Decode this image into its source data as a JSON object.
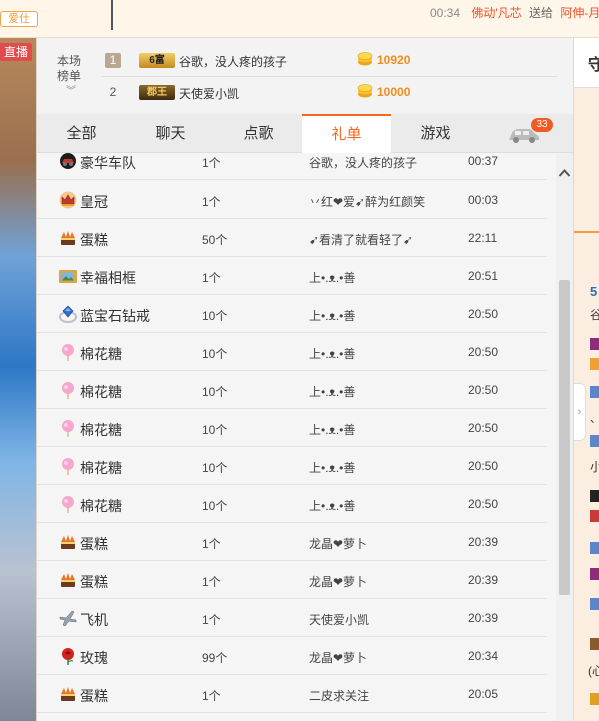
{
  "topbar": {
    "logo": "爱仕",
    "time": "00:34",
    "sender": "佛动'凡芯",
    "action": "送给",
    "receiver": "阿伸-月"
  },
  "video": {
    "live_label": "直播"
  },
  "ranking": {
    "title": "本场榜单",
    "rows": [
      {
        "rank": "1",
        "badge": "6富",
        "name": "谷歌，没人疼的孩子",
        "amount": "10920"
      },
      {
        "rank": "2",
        "badge": "郡王",
        "name": "天使爱小凯",
        "amount": "10000"
      }
    ]
  },
  "tabs": [
    {
      "label": "全部",
      "active": false
    },
    {
      "label": "聊天",
      "active": false
    },
    {
      "label": "点歌",
      "active": false
    },
    {
      "label": "礼单",
      "active": true
    },
    {
      "label": "游戏",
      "active": false
    }
  ],
  "car_badge_count": "33",
  "gifts": [
    {
      "icon": "luxury-car-icon",
      "name": "豪华车队",
      "qty": "1个",
      "user": "谷歌，没人疼的孩子",
      "time": "00:37"
    },
    {
      "icon": "crown-icon",
      "name": "皇冠",
      "qty": "1个",
      "user": "丷红❤爱➹醉为红颜笑",
      "time": "00:03"
    },
    {
      "icon": "cake-icon",
      "name": "蛋糕",
      "qty": "50个",
      "user": "➹看清了就看轻了➹",
      "time": "22:11"
    },
    {
      "icon": "photo-frame-icon",
      "name": "幸福相框",
      "qty": "1个",
      "user": "上•.ᴥ.•善",
      "time": "20:51"
    },
    {
      "icon": "sapphire-ring-icon",
      "name": "蓝宝石钻戒",
      "qty": "10个",
      "user": "上•.ᴥ.•善",
      "time": "20:50"
    },
    {
      "icon": "cotton-candy-icon",
      "name": "棉花糖",
      "qty": "10个",
      "user": "上•.ᴥ.•善",
      "time": "20:50"
    },
    {
      "icon": "cotton-candy-icon",
      "name": "棉花糖",
      "qty": "10个",
      "user": "上•.ᴥ.•善",
      "time": "20:50"
    },
    {
      "icon": "cotton-candy-icon",
      "name": "棉花糖",
      "qty": "10个",
      "user": "上•.ᴥ.•善",
      "time": "20:50"
    },
    {
      "icon": "cotton-candy-icon",
      "name": "棉花糖",
      "qty": "10个",
      "user": "上•.ᴥ.•善",
      "time": "20:50"
    },
    {
      "icon": "cotton-candy-icon",
      "name": "棉花糖",
      "qty": "10个",
      "user": "上•.ᴥ.•善",
      "time": "20:50"
    },
    {
      "icon": "cake-icon",
      "name": "蛋糕",
      "qty": "1个",
      "user": "龙晶❤萝卜",
      "time": "20:39"
    },
    {
      "icon": "cake-icon",
      "name": "蛋糕",
      "qty": "1个",
      "user": "龙晶❤萝卜",
      "time": "20:39"
    },
    {
      "icon": "airplane-icon",
      "name": "飞机",
      "qty": "1个",
      "user": "天使爱小凯",
      "time": "20:39"
    },
    {
      "icon": "rose-icon",
      "name": "玫瑰",
      "qty": "99个",
      "user": "龙晶❤萝卜",
      "time": "20:34"
    },
    {
      "icon": "cake-icon",
      "name": "蛋糕",
      "qty": "1个",
      "user": "二皮求关注",
      "time": "20:05"
    }
  ],
  "right_panel": {
    "top_char": "守",
    "texts": [
      "5",
      "谷",
      "小",
      "、",
      "(心"
    ]
  },
  "colors": {
    "accent": "#f5681e",
    "amount": "#f08c1e",
    "live": "#e24b4b",
    "sender": "#e8542b"
  }
}
